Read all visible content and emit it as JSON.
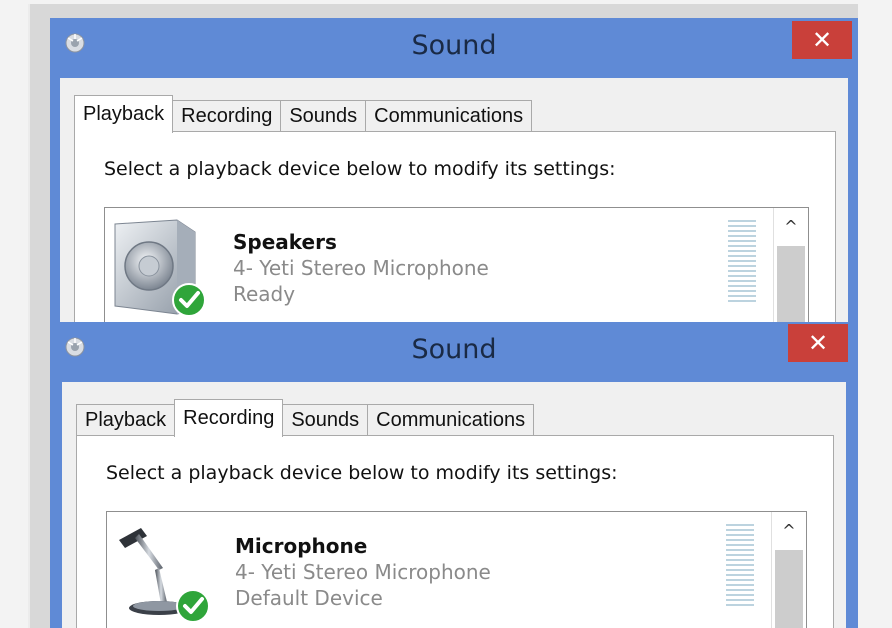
{
  "windows": [
    {
      "title": "Sound",
      "close_label": "✕",
      "tabs": [
        {
          "label": "Playback",
          "active": true
        },
        {
          "label": "Recording",
          "active": false
        },
        {
          "label": "Sounds",
          "active": false
        },
        {
          "label": "Communications",
          "active": false
        }
      ],
      "instruction": "Select a playback device below to modify its settings:",
      "device": {
        "name": "Speakers",
        "sub": "4- Yeti Stereo Microphone",
        "status": "Ready",
        "icon": "speaker-icon"
      },
      "scroll_up": "^"
    },
    {
      "title": "Sound",
      "close_label": "✕",
      "tabs": [
        {
          "label": "Playback",
          "active": false
        },
        {
          "label": "Recording",
          "active": true
        },
        {
          "label": "Sounds",
          "active": false
        },
        {
          "label": "Communications",
          "active": false
        }
      ],
      "instruction": "Select a playback device below to modify its settings:",
      "device": {
        "name": "Microphone",
        "sub": "4- Yeti Stereo Microphone",
        "status": "Default Device",
        "icon": "microphone-icon"
      },
      "scroll_up": "^"
    }
  ],
  "colors": {
    "titlebar": "#5f8ad6",
    "close": "#c9403a",
    "check": "#2fa53a"
  }
}
